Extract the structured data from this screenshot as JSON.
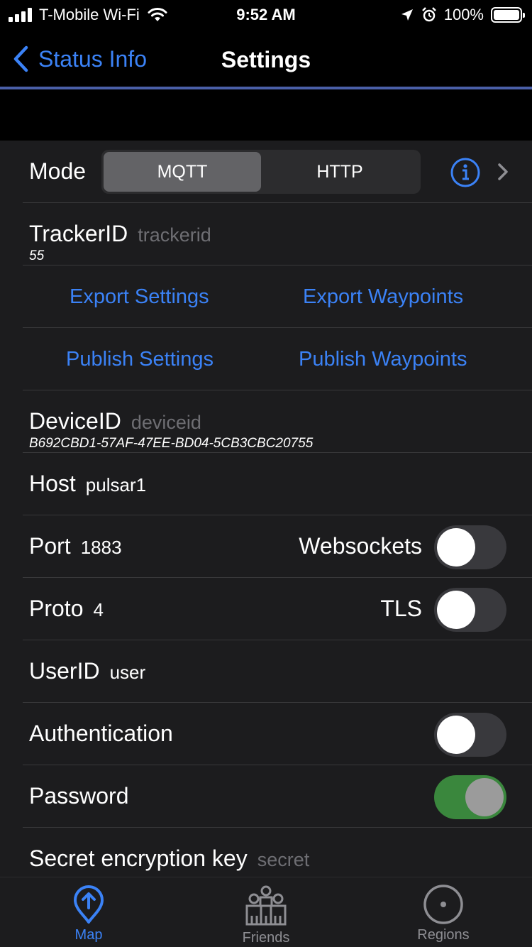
{
  "status_bar": {
    "carrier": "T-Mobile Wi-Fi",
    "time": "9:52 AM",
    "battery": "100%"
  },
  "nav": {
    "back_label": "Status Info",
    "title": "Settings"
  },
  "mode": {
    "label": "Mode",
    "options": [
      "MQTT",
      "HTTP"
    ],
    "selected": "MQTT"
  },
  "tracker": {
    "label": "TrackerID",
    "placeholder": "trackerid",
    "value": "55"
  },
  "actions": {
    "export_settings": "Export Settings",
    "export_waypoints": "Export Waypoints",
    "publish_settings": "Publish Settings",
    "publish_waypoints": "Publish Waypoints"
  },
  "device": {
    "label": "DeviceID",
    "placeholder": "deviceid",
    "value": "B692CBD1-57AF-47EE-BD04-5CB3CBC20755"
  },
  "host": {
    "label": "Host",
    "value": "pulsar1"
  },
  "port": {
    "label": "Port",
    "value": "1883",
    "toggle_label": "Websockets",
    "toggle_on": false
  },
  "proto": {
    "label": "Proto",
    "value": "4",
    "toggle_label": "TLS",
    "toggle_on": false
  },
  "user": {
    "label": "UserID",
    "value": "user"
  },
  "authentication": {
    "label": "Authentication",
    "toggle_on": false
  },
  "password": {
    "label": "Password",
    "toggle_on": true
  },
  "secret": {
    "label": "Secret encryption key",
    "placeholder": "secret"
  },
  "tabs": [
    {
      "label": "Map",
      "icon": "map-pin-icon",
      "active": true
    },
    {
      "label": "Friends",
      "icon": "friends-icon",
      "active": false
    },
    {
      "label": "Regions",
      "icon": "regions-icon",
      "active": false
    }
  ],
  "colors": {
    "accent": "#3b82f6",
    "toggle_on": "#3a873d",
    "background": "#1c1c1e"
  }
}
